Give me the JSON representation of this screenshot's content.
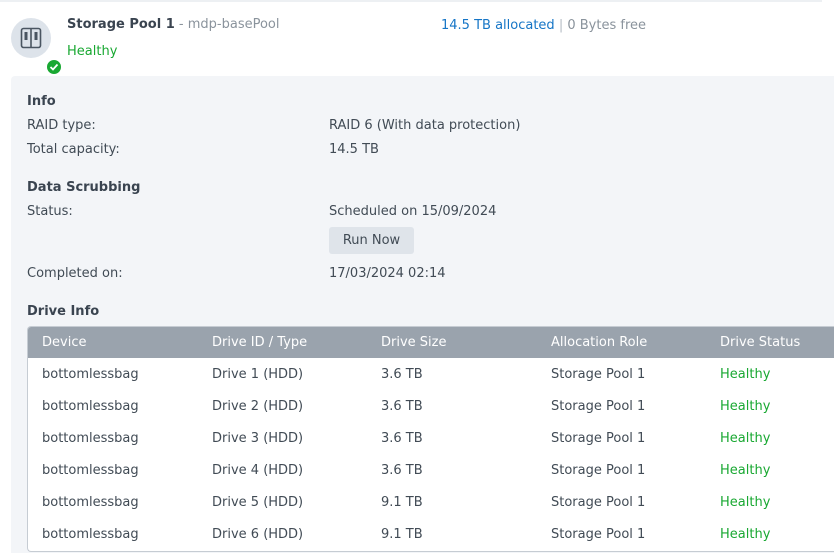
{
  "pool": {
    "name": "Storage Pool 1",
    "separator": "-",
    "description": "mdp-basePool",
    "status": "Healthy",
    "allocated": "14.5 TB allocated",
    "usage_separator": "|",
    "free": "0 Bytes free",
    "icon": "nas-icon",
    "status_icon": "check-circle-icon",
    "status_color": "#19a832",
    "link_color": "#1575c6"
  },
  "info": {
    "heading": "Info",
    "raid_type_label": "RAID type:",
    "raid_type_value": "RAID 6 (With data protection)",
    "capacity_label": "Total capacity:",
    "capacity_value": "14.5 TB"
  },
  "scrubbing": {
    "heading": "Data Scrubbing",
    "status_label": "Status:",
    "status_value": "Scheduled on 15/09/2024",
    "run_now_label": "Run Now",
    "completed_label": "Completed on:",
    "completed_value": "17/03/2024 02:14"
  },
  "drive_info": {
    "heading": "Drive Info",
    "columns": [
      "Device",
      "Drive ID / Type",
      "Drive Size",
      "Allocation Role",
      "Drive Status"
    ],
    "rows": [
      [
        "bottomlessbag",
        "Drive 1 (HDD)",
        "3.6 TB",
        "Storage Pool 1",
        "Healthy"
      ],
      [
        "bottomlessbag",
        "Drive 2 (HDD)",
        "3.6 TB",
        "Storage Pool 1",
        "Healthy"
      ],
      [
        "bottomlessbag",
        "Drive 3 (HDD)",
        "3.6 TB",
        "Storage Pool 1",
        "Healthy"
      ],
      [
        "bottomlessbag",
        "Drive 4 (HDD)",
        "3.6 TB",
        "Storage Pool 1",
        "Healthy"
      ],
      [
        "bottomlessbag",
        "Drive 5 (HDD)",
        "9.1 TB",
        "Storage Pool 1",
        "Healthy"
      ],
      [
        "bottomlessbag",
        "Drive 6 (HDD)",
        "9.1 TB",
        "Storage Pool 1",
        "Healthy"
      ]
    ]
  }
}
